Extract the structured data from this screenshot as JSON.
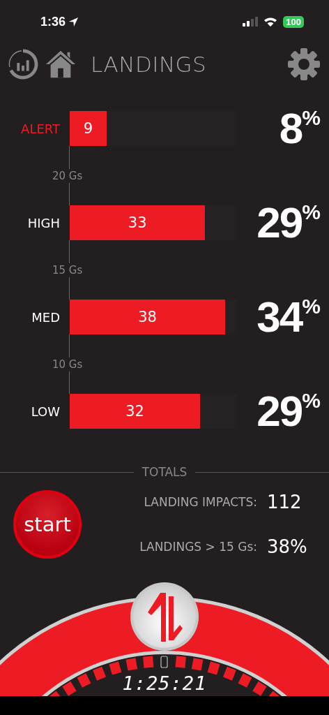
{
  "status_bar": {
    "time": "1:36",
    "battery": "100"
  },
  "header": {
    "title": "LANDINGS"
  },
  "rows": [
    {
      "label": "ALERT",
      "alert": true,
      "count": "9",
      "level": 0.22,
      "percent": "8$^{%}$"
    },
    {
      "label": "HIGH",
      "alert": false,
      "count": "33",
      "level": 0.81,
      "percent": "29$^{%}$"
    },
    {
      "label": "MED",
      "alert": false,
      "count": "38",
      "level": 0.93,
      "percent": "34$^{%}$"
    },
    {
      "label": "LOW",
      "alert": false,
      "count": "32",
      "level": 0.78,
      "percent": "29$^{%}$"
    }
  ],
  "thresholds": [
    "20 Gs",
    "15 Gs",
    "10 Gs"
  ],
  "totals": {
    "title": "TOTALS",
    "items": [
      {
        "label": "LANDING IMPACTS:",
        "value": "112"
      },
      {
        "label": "LANDINGS > 15 Gs:",
        "value": "38%"
      }
    ]
  },
  "start_button": {
    "label": "start"
  },
  "dial": {
    "timer": "1:25:21"
  }
}
